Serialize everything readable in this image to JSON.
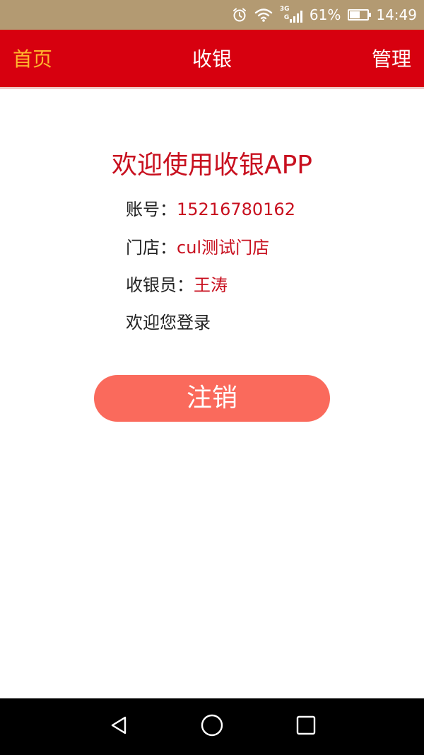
{
  "status_bar": {
    "network_top": "3G",
    "network_bottom": "G",
    "battery_text": "61%",
    "battery_level": 0.61,
    "time": "14:49",
    "icons": [
      "alarm-icon",
      "wifi-icon",
      "signal-icon",
      "battery-icon"
    ]
  },
  "header": {
    "home_label": "首页",
    "title": "收银",
    "manage_label": "管理",
    "bg_color": "#d7000f",
    "home_color": "#ffb52e"
  },
  "welcome": {
    "title": "欢迎使用收银APP",
    "account_label": "账号：",
    "account_value": "15216780162",
    "store_label": "门店：",
    "store_value": "cul测试门店",
    "cashier_label": "收银员：",
    "cashier_value": "王涛",
    "greeting": "欢迎您登录",
    "accent_color": "#c8101f"
  },
  "actions": {
    "logout_label": "注销",
    "logout_color": "#fa6a5c"
  },
  "nav_bar": {
    "icons": [
      "back-icon",
      "home-icon",
      "recent-apps-icon"
    ]
  }
}
